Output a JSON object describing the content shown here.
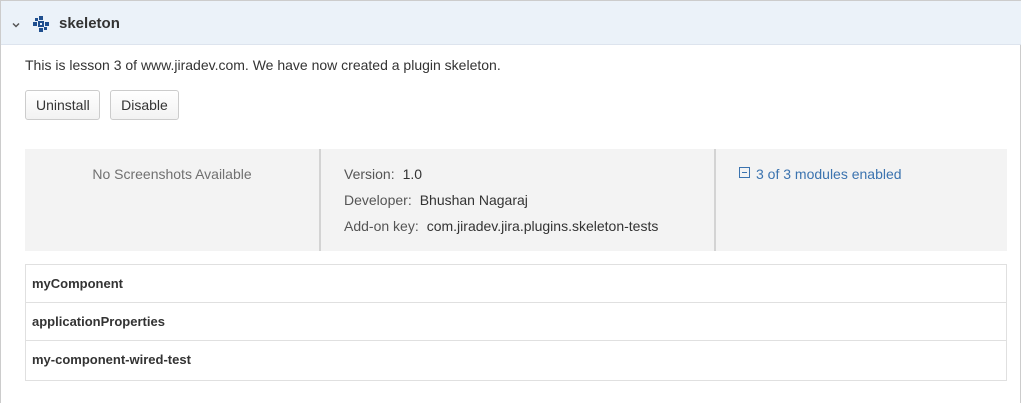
{
  "plugin": {
    "name": "skeleton",
    "description": "This is lesson 3 of www.jiradev.com. We have now created a plugin skeleton."
  },
  "actions": {
    "uninstall_label": "Uninstall",
    "disable_label": "Disable"
  },
  "info": {
    "no_screenshots": "No Screenshots Available",
    "version_label": "Version:",
    "version_value": "1.0",
    "developer_label": "Developer:",
    "developer_value": "Bhushan Nagaraj",
    "addon_key_label": "Add-on key:",
    "addon_key_value": "com.jiradev.jira.plugins.skeleton-tests",
    "modules_link": "3 of 3 modules enabled"
  },
  "modules": [
    {
      "name": "myComponent"
    },
    {
      "name": "applicationProperties"
    },
    {
      "name": "my-component-wired-test"
    }
  ],
  "colors": {
    "header_bg": "#ebf2f9",
    "link": "#3b73af",
    "info_bg": "#f3f3f3"
  },
  "icons": {
    "chevron": "chevron-down-icon",
    "plugin": "plugin-icon",
    "collapse": "collapse-icon"
  }
}
